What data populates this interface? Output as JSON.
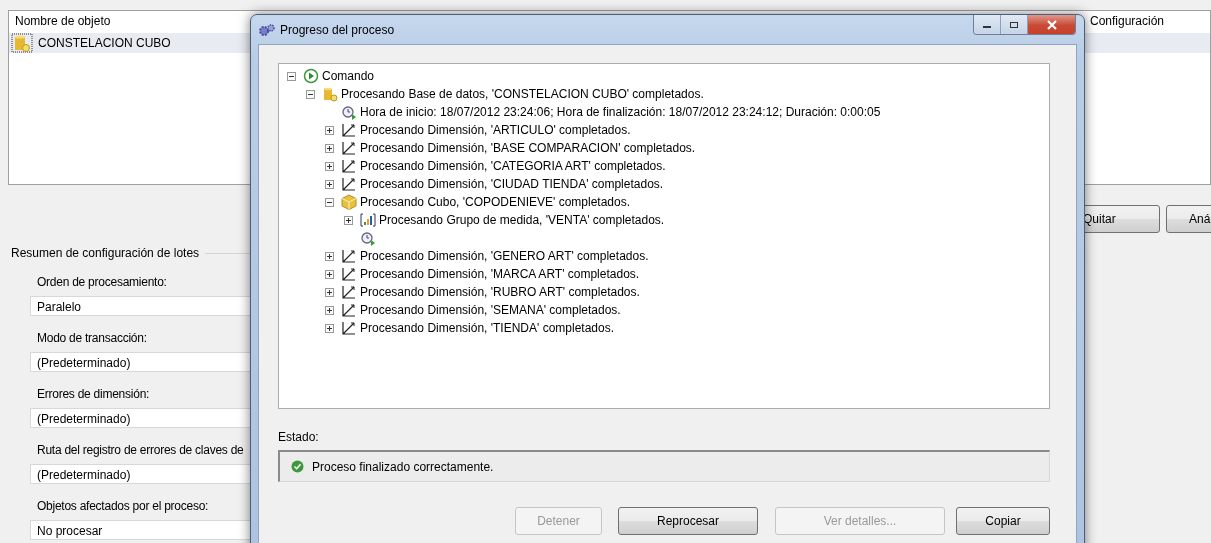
{
  "list": {
    "headers": [
      "Nombre de objeto",
      "Configuración"
    ],
    "rows": [
      {
        "name": "CONSTELACION CUBO",
        "selected": true
      }
    ]
  },
  "list_buttons": [
    "Quitar",
    "Aná"
  ],
  "batch_summary": {
    "title": "Resumen de configuración de lotes",
    "settings": [
      {
        "label": "Orden de procesamiento:",
        "value": "Paralelo"
      },
      {
        "label": "Modo de transacción:",
        "value": "(Predeterminado)"
      },
      {
        "label": "Errores de dimensión:",
        "value": "(Predeterminado)"
      },
      {
        "label": "Ruta del registro de errores de claves de",
        "value": "(Predeterminado)"
      },
      {
        "label": "Objetos afectados por el proceso:",
        "value": "No procesar"
      }
    ]
  },
  "dialog": {
    "title": "Progreso del proceso",
    "tree": [
      {
        "kind": "command",
        "text": "Comando",
        "expanded": true,
        "children": [
          {
            "kind": "database",
            "text": "Procesando Base de datos, 'CONSTELACION CUBO' completados.",
            "expanded": true,
            "children": [
              {
                "kind": "time",
                "text": "Hora de inicio: 18/07/2012 23:24:06; Hora de finalización: 18/07/2012 23:24:12; Duración: 0:00:05"
              },
              {
                "kind": "dimension",
                "text": "Procesando Dimensión, 'ARTICULO' completados.",
                "expanded": false
              },
              {
                "kind": "dimension",
                "text": "Procesando Dimensión, 'BASE COMPARACION' completados.",
                "expanded": false
              },
              {
                "kind": "dimension",
                "text": "Procesando Dimensión, 'CATEGORIA ART' completados.",
                "expanded": false
              },
              {
                "kind": "dimension",
                "text": "Procesando Dimensión, 'CIUDAD TIENDA' completados.",
                "expanded": false
              },
              {
                "kind": "cube",
                "text": "Procesando Cubo, 'COPODENIEVE' completados.",
                "expanded": true,
                "children": [
                  {
                    "kind": "measure_group",
                    "text": "Procesando Grupo de medida, 'VENTA' completados.",
                    "expanded": false
                  },
                  {
                    "kind": "time"
                  }
                ]
              },
              {
                "kind": "dimension",
                "text": "Procesando Dimensión, 'GENERO ART' completados.",
                "expanded": false
              },
              {
                "kind": "dimension",
                "text": "Procesando Dimensión, 'MARCA ART' completados.",
                "expanded": false
              },
              {
                "kind": "dimension",
                "text": "Procesando Dimensión, 'RUBRO ART' completados.",
                "expanded": false
              },
              {
                "kind": "dimension",
                "text": "Procesando Dimensión, 'SEMANA' completados.",
                "expanded": false
              },
              {
                "kind": "dimension",
                "text": "Procesando Dimensión, 'TIENDA' completados.",
                "expanded": false
              }
            ]
          }
        ]
      }
    ],
    "status_label": "Estado:",
    "status": {
      "kind": "success",
      "text": "Proceso finalizado correctamente."
    },
    "buttons": [
      {
        "label": "Detener",
        "disabled": true
      },
      {
        "label": "Reprocesar",
        "disabled": false
      },
      {
        "label": "Ver detalles...",
        "disabled": true
      },
      {
        "label": "Copiar",
        "disabled": false
      }
    ]
  }
}
